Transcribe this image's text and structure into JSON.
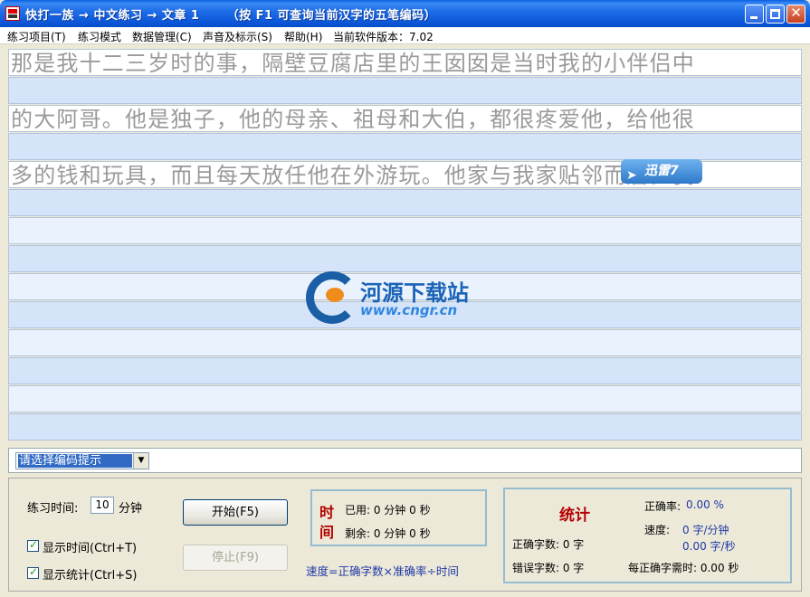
{
  "window": {
    "title": "快打一族 → 中文练习 → 文章 1      （按 F1 可查询当前汉字的五笔编码）",
    "buttons": {
      "minimize": "minimize",
      "maximize": "maximize",
      "close": "✕"
    }
  },
  "menu": {
    "items": [
      "练习项目(T)",
      "练习模式",
      "数据管理(C)",
      "声音及标示(S)",
      "帮助(H)",
      "当前软件版本：7.02"
    ]
  },
  "practice": {
    "lines": [
      "那是我十二三岁时的事，隔壁豆腐店里的王囡囡是当时我的小伴侣中",
      "的大阿哥。他是独子，他的母亲、祖母和大伯，都很疼爱他，给他很",
      "多的钱和玩具，而且每天放任他在外游玩。他家与我家贴邻而居。我"
    ]
  },
  "overlays": {
    "xunlei_badge": "迅雷7",
    "logo_title": "河源下载站",
    "logo_url": "www.cngr.cn"
  },
  "hint": {
    "select_value": "请选择编码提示"
  },
  "controls": {
    "practice_time_label": "练习时间:",
    "practice_time_value": "10",
    "minutes_unit": "分钟",
    "show_time_label": "显示时间(Ctrl+T)",
    "show_stats_label": "显示统计(Ctrl+S)",
    "start_button": "开始(F5)",
    "stop_button": "停止(F9)"
  },
  "time_box": {
    "title_1": "时",
    "title_2": "间",
    "used": "已用: 0 分钟  0  秒",
    "remaining": "剩余: 0 分钟  0  秒",
    "formula": "速度=正确字数×准确率÷时间"
  },
  "stats_box": {
    "title": "统计",
    "correct_chars": "正确字数: 0  字",
    "wrong_chars": "错误字数: 0  字",
    "accuracy_label": "正确率:",
    "accuracy_value": "0.00 %",
    "speed_label": "速度:",
    "speed_per_min": "0  字/分钟",
    "speed_per_sec": "0.00  字/秒",
    "time_per_char": "每正确字需时: 0.00  秒"
  }
}
